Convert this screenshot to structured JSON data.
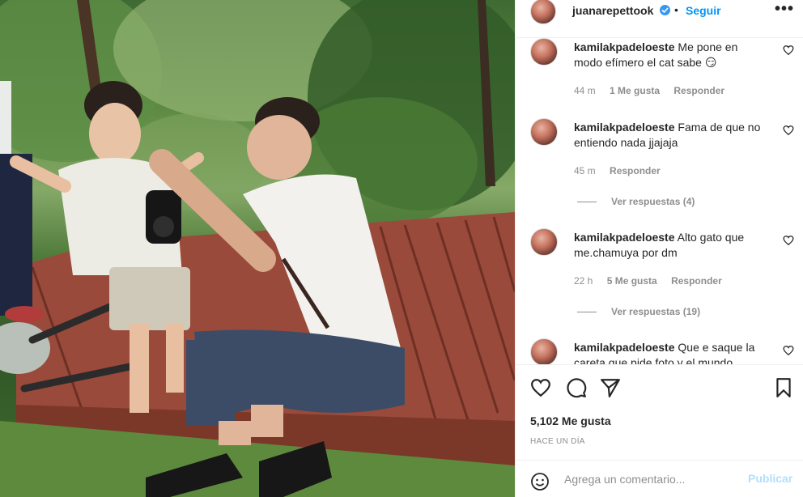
{
  "post": {
    "username": "juanarepettook",
    "separator": "•",
    "follow_label": "Seguir",
    "more_label": "•••"
  },
  "comments": [
    {
      "username": "kamilakpadeloeste",
      "text": "Me pone en modo efímero el cat sabe 😏",
      "time": "44 m",
      "likes": "1 Me gusta",
      "reply_label": "Responder",
      "view_replies": ""
    },
    {
      "username": "kamilakpadeloeste",
      "text": "Fama de que no entiendo nada jjajaja",
      "time": "45 m",
      "likes": "",
      "reply_label": "Responder",
      "view_replies": "Ver respuestas (4)"
    },
    {
      "username": "kamilakpadeloeste",
      "text": "Alto gato que me.chamuya por dm",
      "time": "22 h",
      "likes": "5 Me gusta",
      "reply_label": "Responder",
      "view_replies": "Ver respuestas (19)"
    },
    {
      "username": "kamilakpadeloeste",
      "text": "Que e saque la careta que pide foto y el mundo",
      "time": "",
      "likes": "",
      "reply_label": "",
      "view_replies": ""
    }
  ],
  "actions": {
    "like_icon": "heart-icon",
    "comment_icon": "comment-bubble-icon",
    "share_icon": "paper-plane-icon",
    "save_icon": "bookmark-icon"
  },
  "likes_count": "5,102 Me gusta",
  "time_ago": "HACE UN DÍA",
  "add_comment": {
    "placeholder": "Agrega un comentario...",
    "publish_label": "Publicar"
  },
  "colors": {
    "accent": "#0095f6",
    "publish_disabled": "#b2dffc",
    "muted": "#8e8e8e",
    "text": "#262626"
  }
}
